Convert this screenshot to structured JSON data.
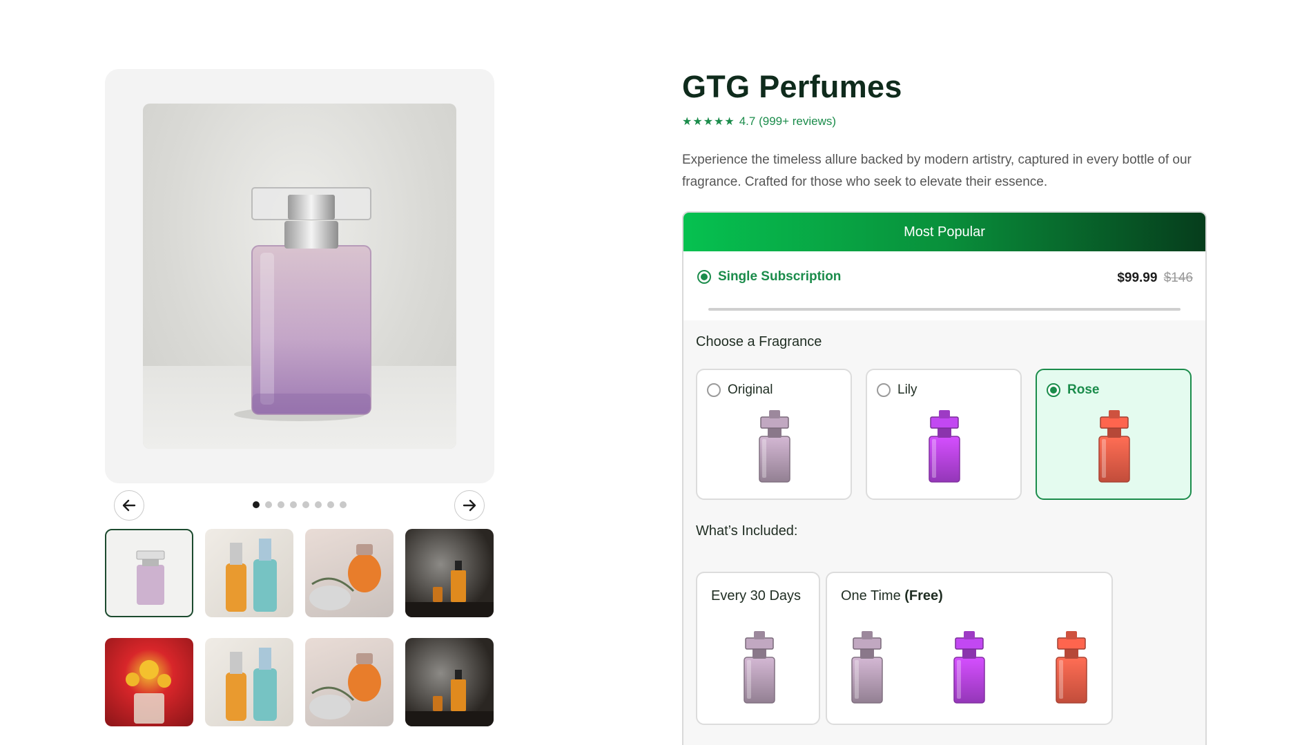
{
  "product": {
    "title": "GTG Perfumes",
    "rating_stars": "★★★★★",
    "rating_text": "4.7 (999+ reviews)",
    "description": "Experience the timeless allure backed by modern artistry, captured in every bottle of our fragrance. Crafted for those who seek to elevate their essence."
  },
  "gallery": {
    "prev_icon": "arrow-left-icon",
    "next_icon": "arrow-right-icon",
    "dot_count": 8,
    "active_dot": 0,
    "active_thumbnail": 0
  },
  "subscription": {
    "banner": "Most Popular",
    "option_label": "Single Subscription",
    "price": "$99.99",
    "original_price": "$146"
  },
  "fragrance": {
    "heading": "Choose a Fragrance",
    "options": [
      {
        "label": "Original",
        "selected": false,
        "color": "#b8a0b8"
      },
      {
        "label": "Lily",
        "selected": false,
        "color": "#b945e6"
      },
      {
        "label": "Rose",
        "selected": true,
        "color": "#f2604a"
      }
    ]
  },
  "included": {
    "heading": "What’s Included:",
    "every_label": "Every 30 Days",
    "one_time_label": "One Time",
    "one_time_badge": "(Free)"
  },
  "colors": {
    "accent_green": "#1b8c4b",
    "banner_start": "#06c150",
    "banner_end": "#063d1c",
    "title_color": "#0f2b1c"
  }
}
